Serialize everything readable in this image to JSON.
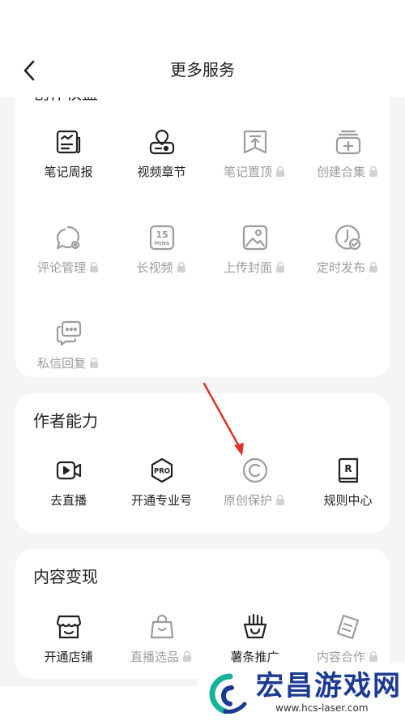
{
  "header": {
    "title": "更多服务"
  },
  "card1": {
    "title": "创作权益",
    "rows": [
      [
        {
          "label": "笔记周报",
          "locked": false,
          "icon": "weekly-report-icon"
        },
        {
          "label": "视频章节",
          "locked": false,
          "icon": "video-chapter-icon"
        },
        {
          "label": "笔记置顶",
          "locked": true,
          "icon": "pin-top-icon"
        },
        {
          "label": "创建合集",
          "locked": true,
          "icon": "create-collection-icon"
        }
      ],
      [
        {
          "label": "评论管理",
          "locked": true,
          "icon": "comment-manage-icon"
        },
        {
          "label": "长视频",
          "locked": true,
          "icon": "long-video-icon"
        },
        {
          "label": "上传封面",
          "locked": true,
          "icon": "upload-cover-icon"
        },
        {
          "label": "定时发布",
          "locked": true,
          "icon": "scheduled-publish-icon"
        }
      ],
      [
        {
          "label": "私信回复",
          "locked": true,
          "icon": "message-reply-icon"
        }
      ]
    ]
  },
  "card2": {
    "title": "作者能力",
    "items": [
      {
        "label": "去直播",
        "locked": false,
        "icon": "live-camera-icon"
      },
      {
        "label": "开通专业号",
        "locked": false,
        "icon": "pro-badge-icon"
      },
      {
        "label": "原创保护",
        "locked": true,
        "icon": "copyright-icon"
      },
      {
        "label": "规则中心",
        "locked": false,
        "icon": "rules-book-icon"
      }
    ]
  },
  "card3": {
    "title": "内容变现",
    "items": [
      {
        "label": "开通店铺",
        "locked": false,
        "icon": "store-icon"
      },
      {
        "label": "直播选品",
        "locked": true,
        "icon": "shopping-bag-icon"
      },
      {
        "label": "薯条推广",
        "locked": false,
        "icon": "fries-promo-icon"
      },
      {
        "label": "内容合作",
        "locked": true,
        "icon": "content-cooperation-icon"
      }
    ]
  },
  "watermark": {
    "name": "宏昌游戏网",
    "url": "www.hcs-laser.com"
  },
  "icon_text": {
    "long_video": [
      "15",
      "MINS"
    ],
    "pro": "PRO",
    "rules": "R"
  },
  "colors": {
    "active": "#222222",
    "locked": "#9c9c9c",
    "arrow": "#e0332b",
    "watermark": "#1b3a92"
  }
}
